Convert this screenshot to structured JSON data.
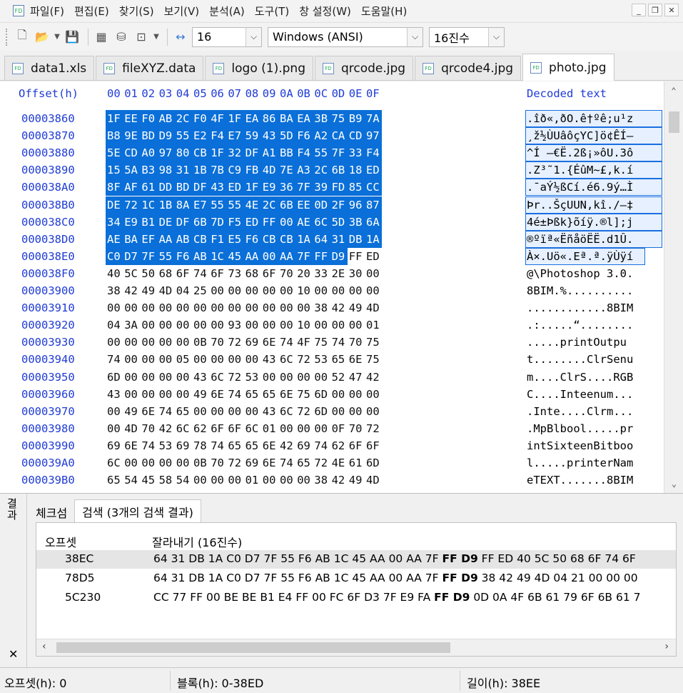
{
  "menu": [
    "파일(F)",
    "편집(E)",
    "찾기(S)",
    "보기(V)",
    "분석(A)",
    "도구(T)",
    "창 설정(W)",
    "도움말(H)"
  ],
  "toolbar": {
    "bytes_per_row": "16",
    "encoding": "Windows (ANSI)",
    "numbase": "16진수"
  },
  "tabs": [
    "data1.xls",
    "fileXYZ.data",
    "logo (1).png",
    "qrcode.jpg",
    "qrcode4.jpg",
    "photo.jpg"
  ],
  "active_tab": 5,
  "hex": {
    "offset_label": "Offset(h)",
    "decoded_label": "Decoded text",
    "columns": [
      "00",
      "01",
      "02",
      "03",
      "04",
      "05",
      "06",
      "07",
      "08",
      "09",
      "0A",
      "0B",
      "0C",
      "0D",
      "0E",
      "0F"
    ],
    "rows": [
      {
        "offset": "00003860",
        "bytes": [
          "1F",
          "EE",
          "F0",
          "AB",
          "2C",
          "F0",
          "4F",
          "1F",
          "EA",
          "86",
          "BA",
          "EA",
          "3B",
          "75",
          "B9",
          "7A"
        ],
        "text": ".îð«,ðO.ê†ºê;u¹z"
      },
      {
        "offset": "00003870",
        "bytes": [
          "B8",
          "9E",
          "BD",
          "D9",
          "55",
          "E2",
          "F4",
          "E7",
          "59",
          "43",
          "5D",
          "F6",
          "A2",
          "CA",
          "CD",
          "97"
        ],
        "text": "¸ž½ÙUâôçYC]ö¢ÊÍ—"
      },
      {
        "offset": "00003880",
        "bytes": [
          "5E",
          "CD",
          "A0",
          "97",
          "80",
          "CB",
          "1F",
          "32",
          "DF",
          "A1",
          "BB",
          "F4",
          "55",
          "7F",
          "33",
          "F4"
        ],
        "text": "^Í —€Ë.2ß¡»ôU.3ô"
      },
      {
        "offset": "00003890",
        "bytes": [
          "15",
          "5A",
          "B3",
          "98",
          "31",
          "1B",
          "7B",
          "C9",
          "FB",
          "4D",
          "7E",
          "A3",
          "2C",
          "6B",
          "18",
          "ED"
        ],
        "text": ".Z³˜1.{ÉûM~£,k.í"
      },
      {
        "offset": "000038A0",
        "bytes": [
          "8F",
          "AF",
          "61",
          "DD",
          "BD",
          "DF",
          "43",
          "ED",
          "1F",
          "E9",
          "36",
          "7F",
          "39",
          "FD",
          "85",
          "CC"
        ],
        "text": ".¯aÝ½ßCí.é6.9ý…Ì"
      },
      {
        "offset": "000038B0",
        "bytes": [
          "DE",
          "72",
          "1C",
          "1B",
          "8A",
          "E7",
          "55",
          "55",
          "4E",
          "2C",
          "6B",
          "EE",
          "0D",
          "2F",
          "96",
          "87"
        ],
        "text": "Þr..ŠçUUN,kî./–‡"
      },
      {
        "offset": "000038C0",
        "bytes": [
          "34",
          "E9",
          "B1",
          "DE",
          "DF",
          "6B",
          "7D",
          "F5",
          "ED",
          "FF",
          "00",
          "AE",
          "6C",
          "5D",
          "3B",
          "6A"
        ],
        "text": "4é±Þßk}õíÿ.®l];j"
      },
      {
        "offset": "000038D0",
        "bytes": [
          "AE",
          "BA",
          "EF",
          "AA",
          "AB",
          "CB",
          "F1",
          "E5",
          "F6",
          "CB",
          "CB",
          "1A",
          "64",
          "31",
          "DB",
          "1A"
        ],
        "text": "®ºïª«ËñåöËË.d1Û."
      },
      {
        "offset": "000038E0",
        "bytes": [
          "C0",
          "D7",
          "7F",
          "55",
          "F6",
          "AB",
          "1C",
          "45",
          "AA",
          "00",
          "AA",
          "7F",
          "FF",
          "D9",
          "FF",
          "ED"
        ],
        "text": "À×.Uö«.Eª.ª.ÿÙÿí"
      },
      {
        "offset": "000038F0",
        "bytes": [
          "40",
          "5C",
          "50",
          "68",
          "6F",
          "74",
          "6F",
          "73",
          "68",
          "6F",
          "70",
          "20",
          "33",
          "2E",
          "30",
          "00"
        ],
        "text": "@\\Photoshop 3.0."
      },
      {
        "offset": "00003900",
        "bytes": [
          "38",
          "42",
          "49",
          "4D",
          "04",
          "25",
          "00",
          "00",
          "00",
          "00",
          "00",
          "10",
          "00",
          "00",
          "00",
          "00"
        ],
        "text": "8BIM.%.........."
      },
      {
        "offset": "00003910",
        "bytes": [
          "00",
          "00",
          "00",
          "00",
          "00",
          "00",
          "00",
          "00",
          "00",
          "00",
          "00",
          "00",
          "38",
          "42",
          "49",
          "4D"
        ],
        "text": "............8BIM"
      },
      {
        "offset": "00003920",
        "bytes": [
          "04",
          "3A",
          "00",
          "00",
          "00",
          "00",
          "00",
          "93",
          "00",
          "00",
          "00",
          "10",
          "00",
          "00",
          "00",
          "01"
        ],
        "text": ".:.....“........"
      },
      {
        "offset": "00003930",
        "bytes": [
          "00",
          "00",
          "00",
          "00",
          "00",
          "0B",
          "70",
          "72",
          "69",
          "6E",
          "74",
          "4F",
          "75",
          "74",
          "70",
          "75"
        ],
        "text": ".....printOutpu"
      },
      {
        "offset": "00003940",
        "bytes": [
          "74",
          "00",
          "00",
          "00",
          "05",
          "00",
          "00",
          "00",
          "00",
          "43",
          "6C",
          "72",
          "53",
          "65",
          "6E",
          "75"
        ],
        "text": "t........ClrSenu"
      },
      {
        "offset": "00003950",
        "bytes": [
          "6D",
          "00",
          "00",
          "00",
          "00",
          "43",
          "6C",
          "72",
          "53",
          "00",
          "00",
          "00",
          "00",
          "52",
          "47",
          "42"
        ],
        "text": "m....ClrS....RGB"
      },
      {
        "offset": "00003960",
        "bytes": [
          "43",
          "00",
          "00",
          "00",
          "00",
          "49",
          "6E",
          "74",
          "65",
          "65",
          "6E",
          "75",
          "6D",
          "00",
          "00",
          "00"
        ],
        "text": "C....Inteenum..."
      },
      {
        "offset": "00003970",
        "bytes": [
          "00",
          "49",
          "6E",
          "74",
          "65",
          "00",
          "00",
          "00",
          "00",
          "43",
          "6C",
          "72",
          "6D",
          "00",
          "00",
          "00"
        ],
        "text": ".Inte....Clrm..."
      },
      {
        "offset": "00003980",
        "bytes": [
          "00",
          "4D",
          "70",
          "42",
          "6C",
          "62",
          "6F",
          "6F",
          "6C",
          "01",
          "00",
          "00",
          "00",
          "0F",
          "70",
          "72"
        ],
        "text": ".MpBlbool.....pr"
      },
      {
        "offset": "00003990",
        "bytes": [
          "69",
          "6E",
          "74",
          "53",
          "69",
          "78",
          "74",
          "65",
          "65",
          "6E",
          "42",
          "69",
          "74",
          "62",
          "6F",
          "6F"
        ],
        "text": "intSixteenBitboo"
      },
      {
        "offset": "000039A0",
        "bytes": [
          "6C",
          "00",
          "00",
          "00",
          "00",
          "0B",
          "70",
          "72",
          "69",
          "6E",
          "74",
          "65",
          "72",
          "4E",
          "61",
          "6D"
        ],
        "text": "l.....printerNam"
      },
      {
        "offset": "000039B0",
        "bytes": [
          "65",
          "54",
          "45",
          "58",
          "54",
          "00",
          "00",
          "00",
          "01",
          "00",
          "00",
          "00",
          "38",
          "42",
          "49",
          "4D"
        ],
        "text": "eTEXT.......8BIM"
      }
    ],
    "selection_last_row": 8,
    "selection_last_col": 13
  },
  "results": {
    "side_label": "결과",
    "tabs": [
      "체크섬",
      "검색 (3개의 검색 결과)"
    ],
    "col_offset": "오프셋",
    "col_snippet": "잘라내기 (16진수)",
    "rows": [
      {
        "offset": "38EC",
        "pre": "64 31 DB 1A C0 D7 7F 55 F6 AB 1C 45 AA 00 AA 7F ",
        "match": "FF D9",
        "post": " FF ED 40 5C 50 68 6F 74 6F"
      },
      {
        "offset": "78D5",
        "pre": "64 31 DB 1A C0 D7 7F 55 F6 AB 1C 45 AA 00 AA 7F ",
        "match": "FF D9",
        "post": " 38 42 49 4D 04 21 00 00 00"
      },
      {
        "offset": "5C230",
        "pre": "CC 77 FF 00 BE BE B1 E4 FF 00 FC 6F D3 7F E9 FA ",
        "match": "FF D9",
        "post": " 0D 0A 4F 6B 61 79 6F 6B 61 7"
      }
    ]
  },
  "status": {
    "offset": "오프셋(h): 0",
    "block": "블록(h): 0-38ED",
    "length": "길이(h): 38EE"
  }
}
